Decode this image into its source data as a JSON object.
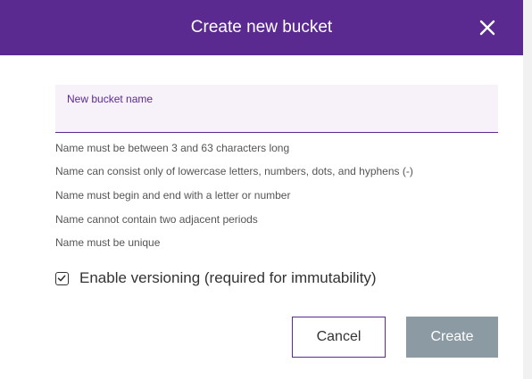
{
  "dialog": {
    "title": "Create new bucket",
    "close_icon": "close-icon",
    "accent_color": "#5b2a91"
  },
  "name_field": {
    "label": "New bucket name",
    "value": ""
  },
  "rules": [
    "Name must be between 3 and 63 characters long",
    "Name can consist only of lowercase letters, numbers, dots, and hyphens (-)",
    "Name must begin and end with a letter or number",
    "Name cannot contain two adjacent periods",
    "Name must be unique"
  ],
  "versioning": {
    "label": "Enable versioning (required for immutability)",
    "checked": true,
    "icon": "checkmark-icon"
  },
  "actions": {
    "cancel_label": "Cancel",
    "create_label": "Create",
    "create_disabled_color": "#8c9aa4"
  }
}
